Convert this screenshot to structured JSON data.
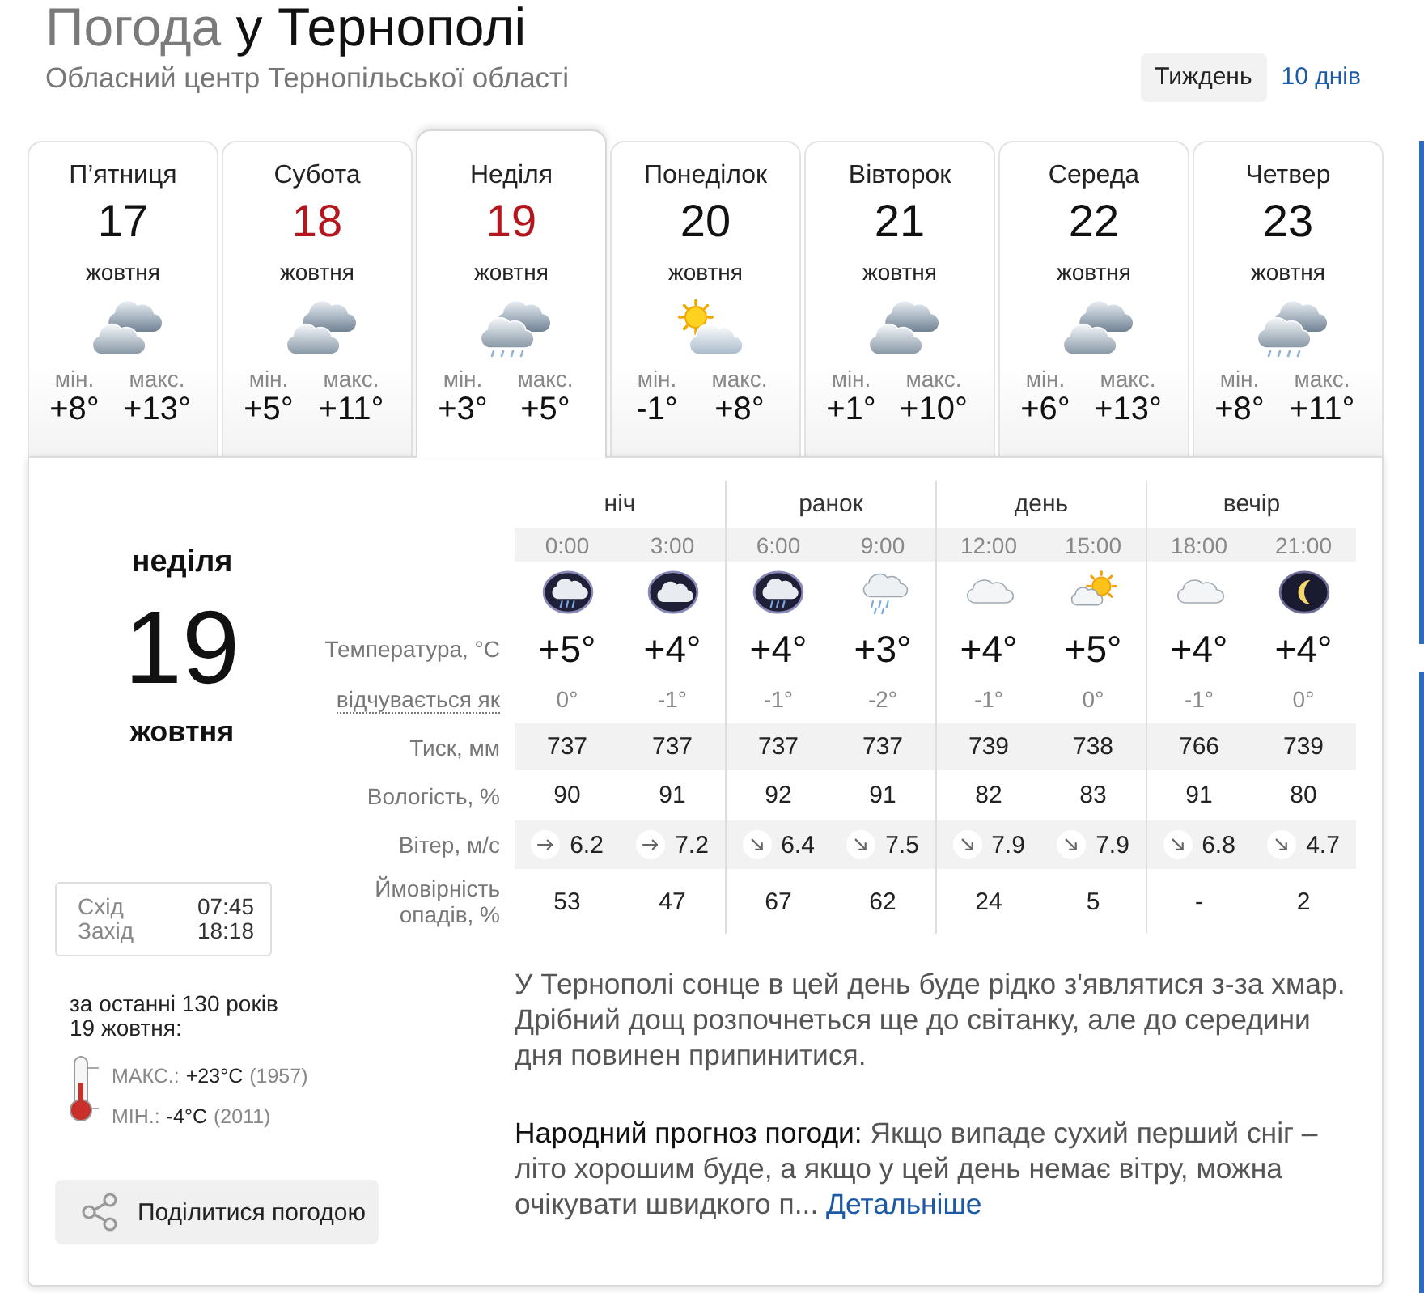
{
  "header": {
    "title_lead": "Погода",
    "title_place": "у Тернополі",
    "subtitle": "Обласний центр Тернопільської області"
  },
  "range_tabs": [
    {
      "label": "Тиждень",
      "selected": true
    },
    {
      "label": "10 днів",
      "selected": false
    }
  ],
  "days": [
    {
      "weekday": "П’ятниця",
      "date": "17",
      "month": "жовтня",
      "weekend": false,
      "selected": false,
      "kind": "overcast",
      "min_label": "мін.",
      "min": "+8°",
      "max_label": "макс.",
      "max": "+13°"
    },
    {
      "weekday": "Субота",
      "date": "18",
      "month": "жовтня",
      "weekend": true,
      "selected": false,
      "kind": "overcast",
      "min_label": "мін.",
      "min": "+5°",
      "max_label": "макс.",
      "max": "+11°"
    },
    {
      "weekday": "Неділя",
      "date": "19",
      "month": "жовтня",
      "weekend": true,
      "selected": true,
      "kind": "overcast-rain",
      "min_label": "мін.",
      "min": "+3°",
      "max_label": "макс.",
      "max": "+5°"
    },
    {
      "weekday": "Понеділок",
      "date": "20",
      "month": "жовтня",
      "weekend": false,
      "selected": false,
      "kind": "partly-sunny",
      "min_label": "мін.",
      "min": "-1°",
      "max_label": "макс.",
      "max": "+8°"
    },
    {
      "weekday": "Вівторок",
      "date": "21",
      "month": "жовтня",
      "weekend": false,
      "selected": false,
      "kind": "overcast",
      "min_label": "мін.",
      "min": "+1°",
      "max_label": "макс.",
      "max": "+10°"
    },
    {
      "weekday": "Середа",
      "date": "22",
      "month": "жовтня",
      "weekend": false,
      "selected": false,
      "kind": "overcast",
      "min_label": "мін.",
      "min": "+6°",
      "max_label": "макс.",
      "max": "+13°"
    },
    {
      "weekday": "Четвер",
      "date": "23",
      "month": "жовтня",
      "weekend": false,
      "selected": false,
      "kind": "overcast-rain",
      "min_label": "мін.",
      "min": "+8°",
      "max_label": "макс.",
      "max": "+11°"
    }
  ],
  "detail": {
    "weekday": "неділя",
    "date": "19",
    "month": "жовтня",
    "sun": [
      {
        "label": "Схід",
        "time": "07:45"
      },
      {
        "label": "Захід",
        "time": "18:18"
      }
    ],
    "history": {
      "intro": "за останні 130 років 19 жовтня:",
      "records": [
        {
          "label": "МАКС.:",
          "value": "+23°C",
          "year": "(1957)"
        },
        {
          "label": "МІН.:",
          "value": "-4°C",
          "year": "(2011)"
        }
      ]
    },
    "share_button": "Поділитися погодою"
  },
  "forecast": {
    "row_labels": {
      "temperature": "Температура, °C",
      "feels_like": "відчувається як",
      "pressure": "Тиск, мм",
      "humidity": "Вологість, %",
      "wind": "Вітер, м/с",
      "precipitation": "Ймовірність опадів, %"
    },
    "periods": [
      {
        "label": "ніч",
        "hours": [
          {
            "time": "0:00",
            "kind": "night-rain",
            "temperature": "+5°",
            "feels_like": "0°",
            "pressure": "737",
            "humidity": "90",
            "wind": {
              "kind": "east",
              "speed": "6.2"
            },
            "precipitation": "53"
          },
          {
            "time": "3:00",
            "kind": "night-cloudy",
            "temperature": "+4°",
            "feels_like": "-1°",
            "pressure": "737",
            "humidity": "91",
            "wind": {
              "kind": "east",
              "speed": "7.2"
            },
            "precipitation": "47"
          }
        ]
      },
      {
        "label": "ранок",
        "hours": [
          {
            "time": "6:00",
            "kind": "night-rain",
            "temperature": "+4°",
            "feels_like": "-1°",
            "pressure": "737",
            "humidity": "92",
            "wind": {
              "kind": "southeast",
              "speed": "6.4"
            },
            "precipitation": "67"
          },
          {
            "time": "9:00",
            "kind": "light-rain",
            "temperature": "+3°",
            "feels_like": "-2°",
            "pressure": "737",
            "humidity": "91",
            "wind": {
              "kind": "southeast",
              "speed": "7.5"
            },
            "precipitation": "62"
          }
        ]
      },
      {
        "label": "день",
        "hours": [
          {
            "time": "12:00",
            "kind": "cloud",
            "temperature": "+4°",
            "feels_like": "-1°",
            "pressure": "739",
            "humidity": "82",
            "wind": {
              "kind": "southeast",
              "speed": "7.9"
            },
            "precipitation": "24"
          },
          {
            "time": "15:00",
            "kind": "sun-cloud",
            "temperature": "+5°",
            "feels_like": "0°",
            "pressure": "738",
            "humidity": "83",
            "wind": {
              "kind": "southeast",
              "speed": "7.9"
            },
            "precipitation": "5"
          }
        ]
      },
      {
        "label": "вечір",
        "hours": [
          {
            "time": "18:00",
            "kind": "cloud",
            "temperature": "+4°",
            "feels_like": "-1°",
            "pressure": "766",
            "humidity": "91",
            "wind": {
              "kind": "southeast",
              "speed": "6.8"
            },
            "precipitation": "-"
          },
          {
            "time": "21:00",
            "kind": "night-clear",
            "temperature": "+4°",
            "feels_like": "0°",
            "pressure": "739",
            "humidity": "80",
            "wind": {
              "kind": "southeast",
              "speed": "4.7"
            },
            "precipitation": "2"
          }
        ]
      }
    ]
  },
  "description": "У Тернополі сонце в цей день буде рідко з'являтися з-за хмар. Дрібний дощ розпочнеться ще до світанку, але до середини дня повинен припинитися.",
  "folk": {
    "label": "Народний прогноз погоди:",
    "text": "Якщо випаде сухий перший сніг – літо хорошим буде, а якщо у цей день немає вітру, можна очікувати швидкого п...",
    "link": "Детальніше"
  }
}
